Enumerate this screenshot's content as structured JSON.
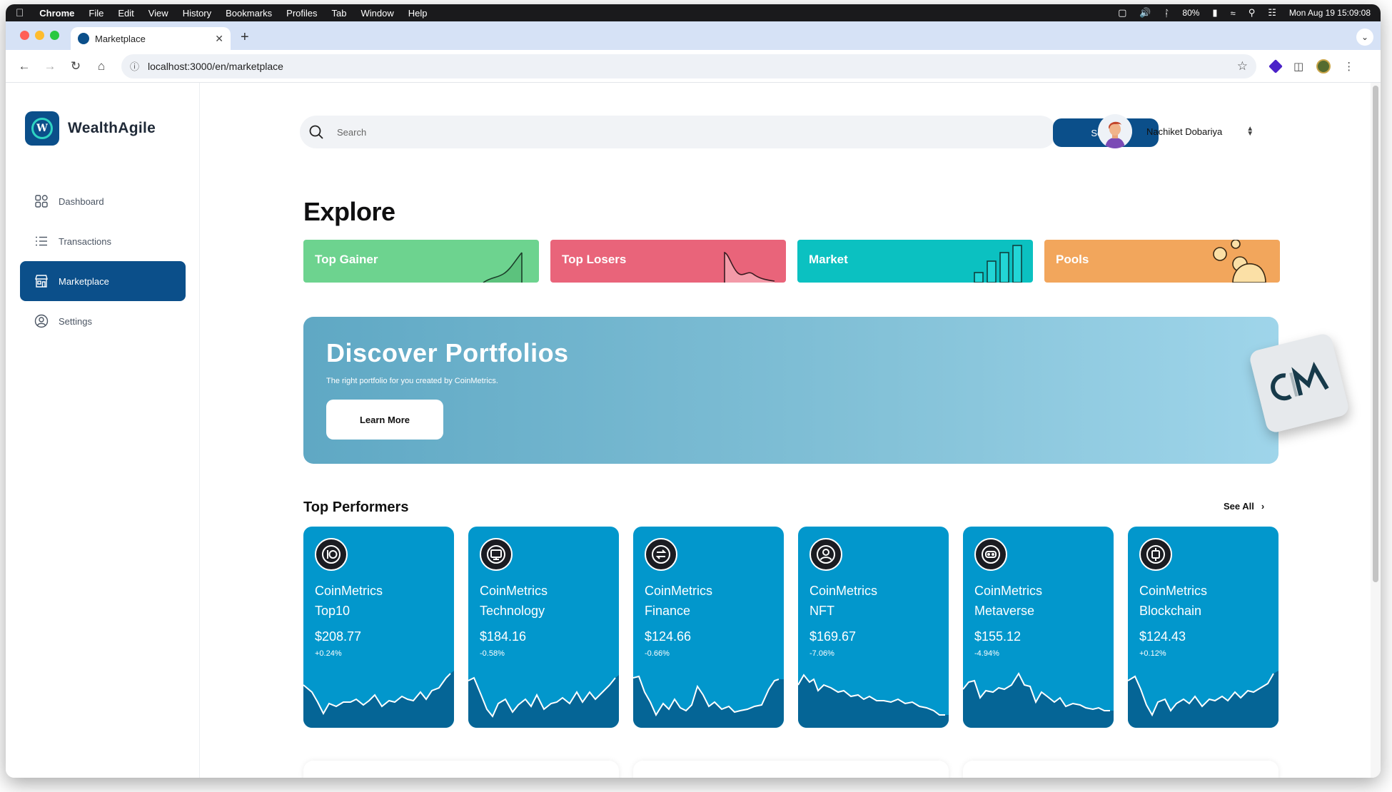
{
  "menubar": {
    "app": "Chrome",
    "items": [
      "File",
      "Edit",
      "View",
      "History",
      "Bookmarks",
      "Profiles",
      "Tab",
      "Window",
      "Help"
    ],
    "battery": "80%",
    "datetime": "Mon Aug 19  15:09:08"
  },
  "browser": {
    "tab_title": "Marketplace",
    "url": "localhost:3000/en/marketplace"
  },
  "brand": {
    "name": "WealthAgile",
    "color": "#0b4f8a"
  },
  "sidebar": {
    "items": [
      {
        "label": "Dashboard",
        "icon": "grid-icon",
        "active": false
      },
      {
        "label": "Transactions",
        "icon": "list-icon",
        "active": false
      },
      {
        "label": "Marketplace",
        "icon": "store-icon",
        "active": true
      },
      {
        "label": "Settings",
        "icon": "gear-icon",
        "active": false
      }
    ]
  },
  "search": {
    "placeholder": "Search",
    "button_label": "Search"
  },
  "user": {
    "name": "Nachiket Dobariya"
  },
  "explore": {
    "title": "Explore",
    "categories": [
      {
        "label": "Top Gainer",
        "color": "#6dd38f"
      },
      {
        "label": "Top Losers",
        "color": "#e9647a"
      },
      {
        "label": "Market",
        "color": "#0bc1c1"
      },
      {
        "label": "Pools",
        "color": "#f2a65c"
      }
    ]
  },
  "banner": {
    "title": "Discover Portfolios",
    "subtitle": "The right portfolio for you created by CoinMetrics.",
    "button_label": "Learn More",
    "logo_text": "CM"
  },
  "top_performers": {
    "title": "Top Performers",
    "see_all": "See All",
    "cards": [
      {
        "line1": "CoinMetrics",
        "line2": "Top10",
        "price": "$208.77",
        "change": "+0.24%",
        "icon": "io-icon"
      },
      {
        "line1": "CoinMetrics",
        "line2": "Technology",
        "price": "$184.16",
        "change": "-0.58%",
        "icon": "monitor-icon"
      },
      {
        "line1": "CoinMetrics",
        "line2": "Finance",
        "price": "$124.66",
        "change": "-0.66%",
        "icon": "exchange-icon"
      },
      {
        "line1": "CoinMetrics",
        "line2": "NFT",
        "price": "$169.67",
        "change": "-7.06%",
        "icon": "user-circle-icon"
      },
      {
        "line1": "CoinMetrics",
        "line2": "Metaverse",
        "price": "$155.12",
        "change": "-4.94%",
        "icon": "vr-headset-icon"
      },
      {
        "line1": "CoinMetrics",
        "line2": "Blockchain",
        "price": "$124.43",
        "change": "+0.12%",
        "icon": "chip-icon"
      }
    ]
  }
}
